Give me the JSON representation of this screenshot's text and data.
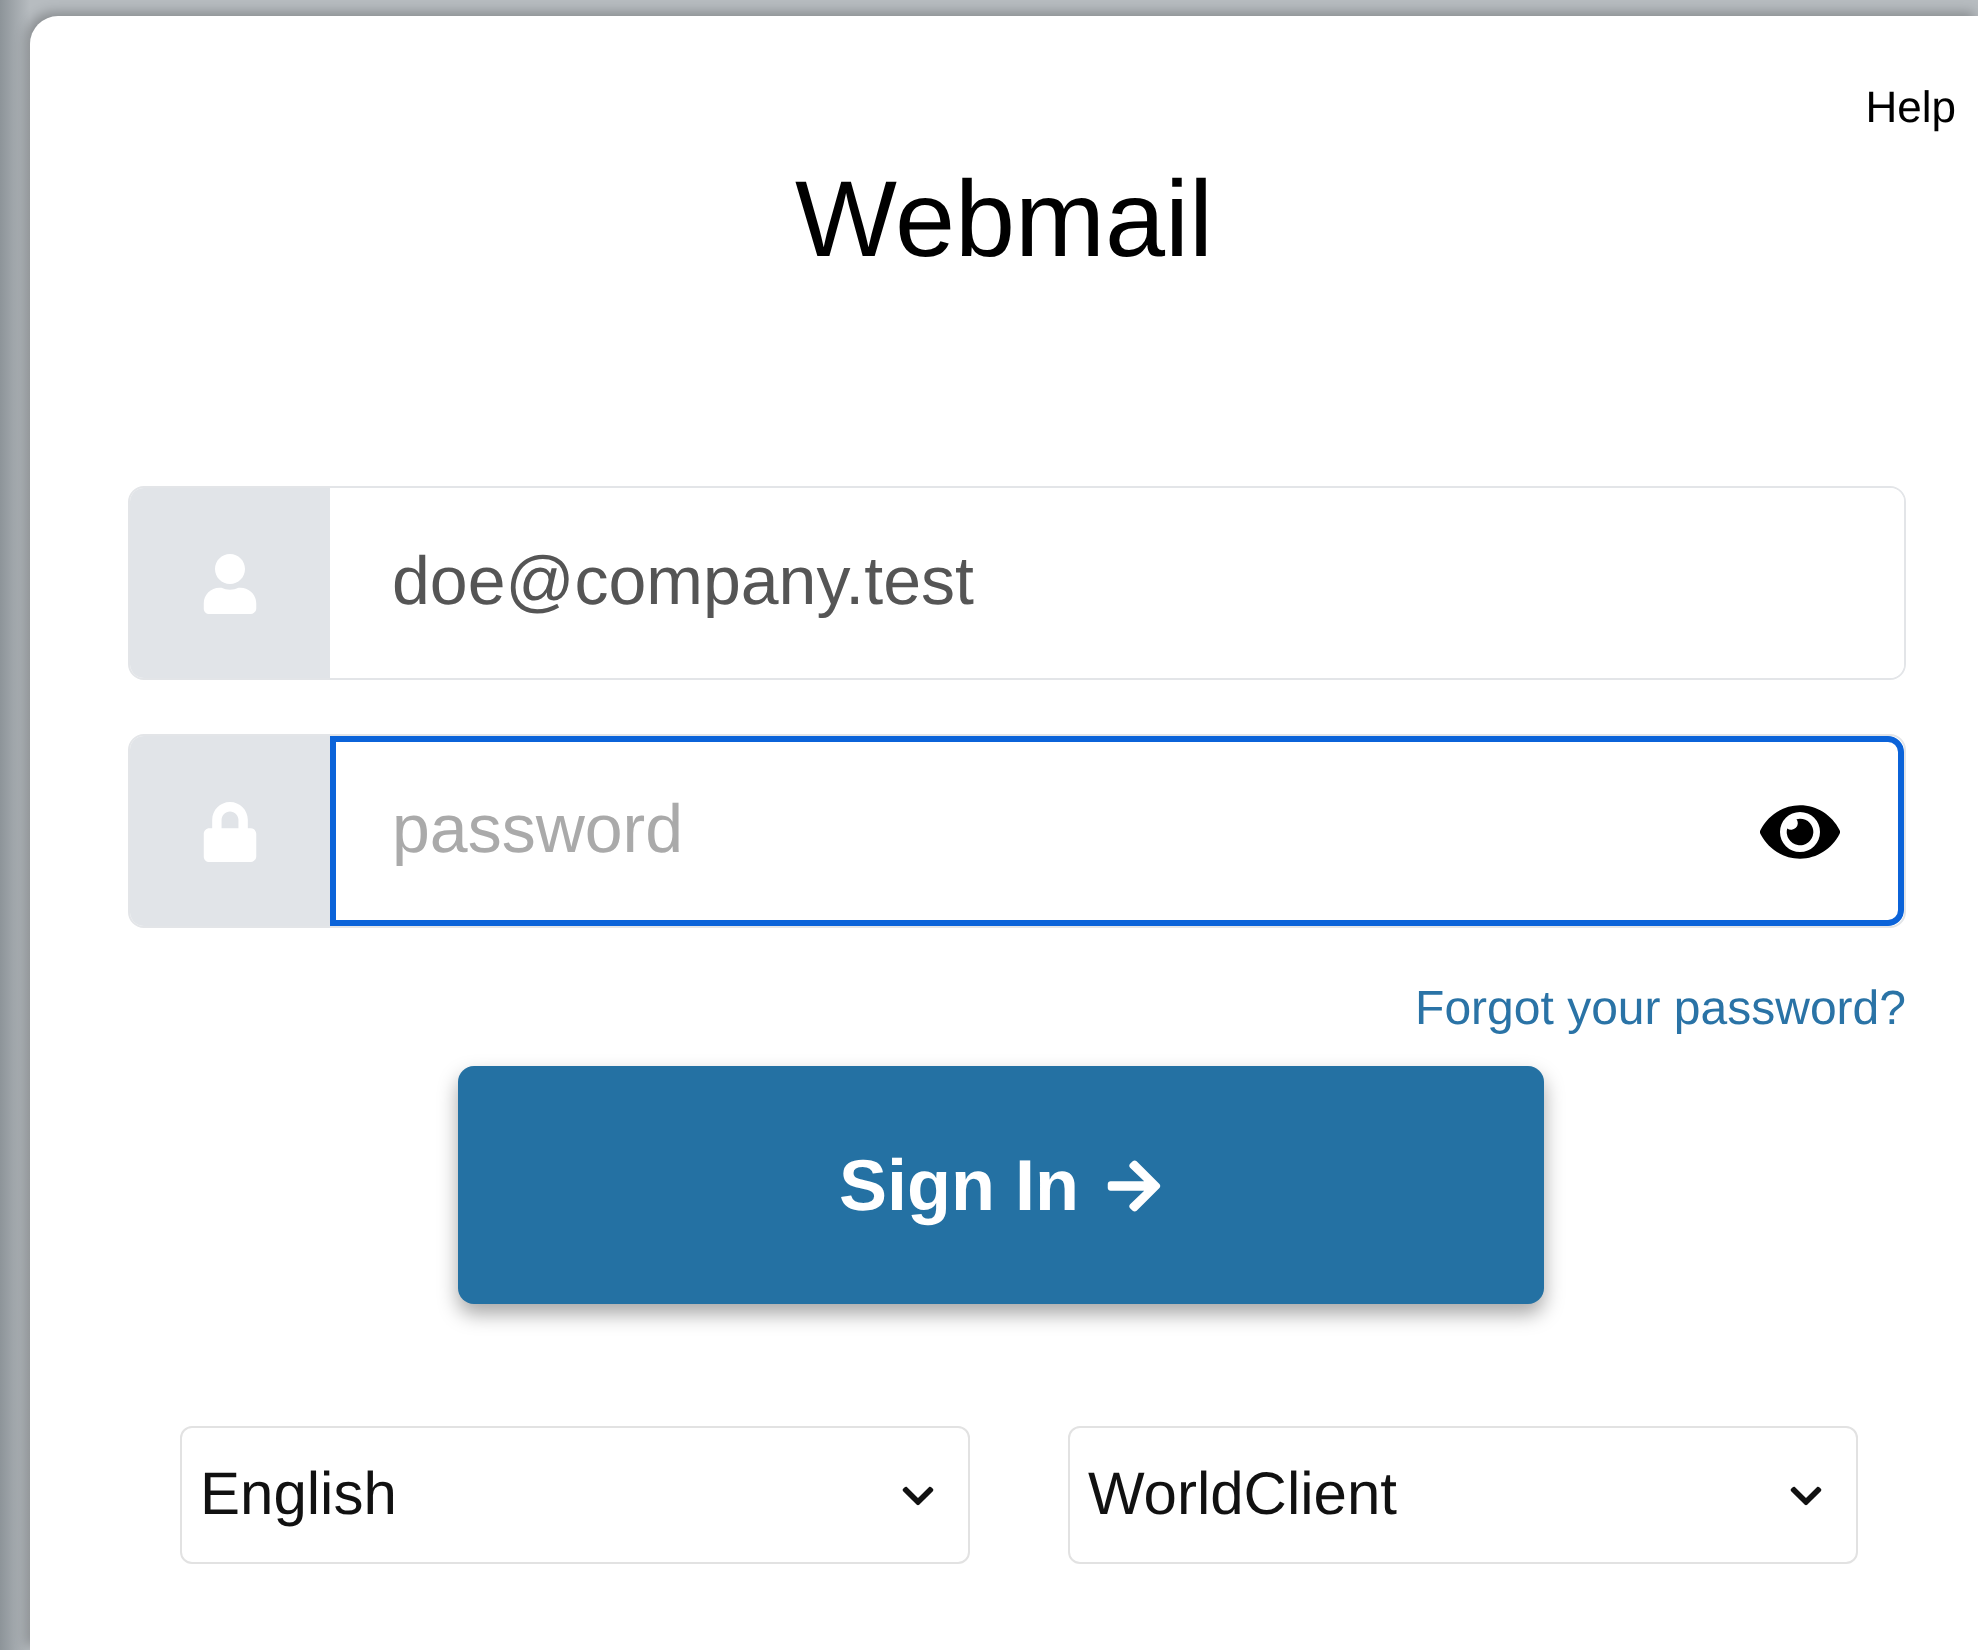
{
  "help_link": "Help",
  "title": "Webmail",
  "fields": [
    {
      "kind": "user",
      "value": "doe@company.test",
      "focused": false
    },
    {
      "kind": "password",
      "placeholder": "password",
      "focused": true
    }
  ],
  "forgot_link": "Forgot your password?",
  "sign_in_button": "Sign In",
  "selects": [
    {
      "value": "English"
    },
    {
      "value": "WorldClient"
    }
  ]
}
